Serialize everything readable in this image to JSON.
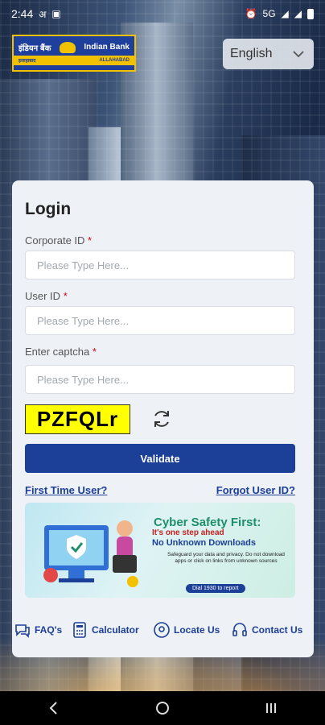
{
  "status_bar": {
    "time": "2:44",
    "network": "5G"
  },
  "logo": {
    "hindi_name": "इंडियन बैंक",
    "english_name": "Indian Bank",
    "sub_left": "इलाहाबाद",
    "sub_right": "ALLAHABAD"
  },
  "language": {
    "selected": "English"
  },
  "login": {
    "title": "Login",
    "corporate_id": {
      "label": "Corporate ID",
      "placeholder": "Please Type Here..."
    },
    "user_id": {
      "label": "User ID",
      "placeholder": "Please Type Here..."
    },
    "captcha_input": {
      "label": "Enter captcha",
      "placeholder": "Please Type Here..."
    },
    "required_mark": "*",
    "captcha_text": "PZFQLr",
    "validate_label": "Validate",
    "first_time_user": "First Time User?",
    "forgot_user_id": "Forgot User ID?"
  },
  "banner": {
    "heading": "Cyber Safety First:",
    "subheading": "It's one step ahead",
    "line": "No Unknown Downloads",
    "body": "Safeguard your data and privacy. Do not download apps or click on links from unknown sources",
    "cta": "Dial 1930 to report"
  },
  "quick_links": [
    {
      "label": "FAQ's",
      "icon": "chat-icon"
    },
    {
      "label": "Calculator",
      "icon": "calculator-icon"
    },
    {
      "label": "Locate Us",
      "icon": "location-icon"
    },
    {
      "label": "Contact Us",
      "icon": "headset-icon"
    }
  ],
  "colors": {
    "primary": "#1c3f97",
    "captcha_bg": "#ffff00",
    "required": "#d0021b"
  }
}
